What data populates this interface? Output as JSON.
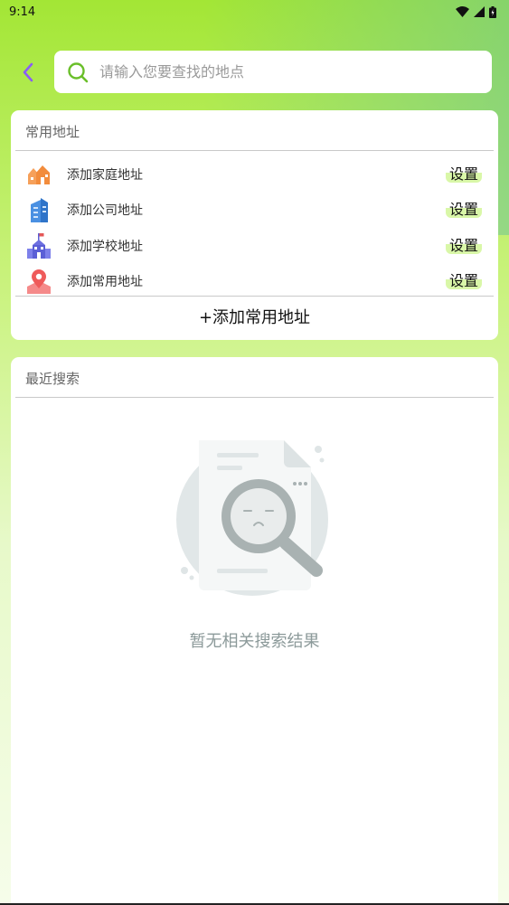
{
  "status_bar": {
    "time": "9:14"
  },
  "search": {
    "placeholder": "请输入您要查找的地点"
  },
  "common_addresses": {
    "title": "常用地址",
    "items": [
      {
        "label": "添加家庭地址",
        "action": "设置",
        "icon": "home-icon"
      },
      {
        "label": "添加公司地址",
        "action": "设置",
        "icon": "office-building-icon"
      },
      {
        "label": "添加学校地址",
        "action": "设置",
        "icon": "school-icon"
      },
      {
        "label": "添加常用地址",
        "action": "设置",
        "icon": "map-pin-icon"
      }
    ],
    "add_button": "+添加常用地址"
  },
  "recent_search": {
    "title": "最近搜索",
    "empty_text": "暂无相关搜索结果"
  },
  "colors": {
    "accent": "#a3e635",
    "back_arrow": "#8b5cf6",
    "search_icon": "#6abf2a",
    "set_highlight": "#d9f7a8"
  }
}
